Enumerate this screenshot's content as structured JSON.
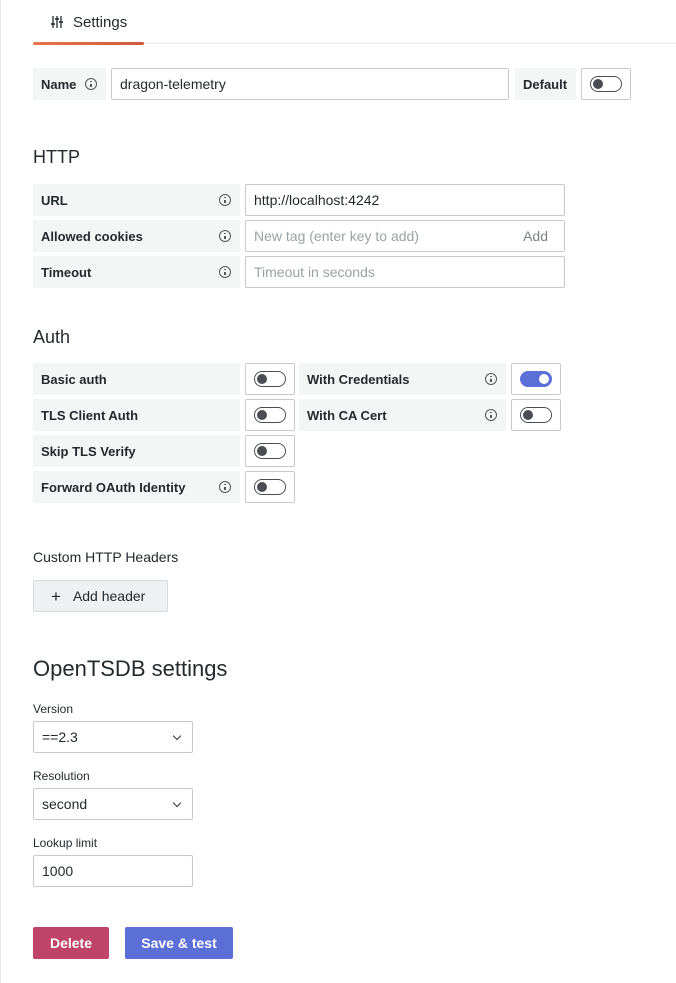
{
  "tabs": [
    {
      "label": "Settings",
      "icon": "sliders-icon",
      "active": true
    }
  ],
  "name_row": {
    "label": "Name",
    "value": "dragon-telemetry",
    "default_label": "Default",
    "default_on": false
  },
  "http": {
    "title": "HTTP",
    "url_label": "URL",
    "url_value": "http://localhost:4242",
    "cookies_label": "Allowed cookies",
    "cookies_placeholder": "New tag (enter key to add)",
    "cookies_add": "Add",
    "timeout_label": "Timeout",
    "timeout_placeholder": "Timeout in seconds"
  },
  "auth": {
    "title": "Auth",
    "basic_auth": {
      "label": "Basic auth",
      "on": false
    },
    "with_credentials": {
      "label": "With Credentials",
      "on": true
    },
    "tls_client_auth": {
      "label": "TLS Client Auth",
      "on": false
    },
    "with_ca_cert": {
      "label": "With CA Cert",
      "on": false
    },
    "skip_tls_verify": {
      "label": "Skip TLS Verify",
      "on": false
    },
    "forward_oauth": {
      "label": "Forward OAuth Identity",
      "on": false
    }
  },
  "headers": {
    "title": "Custom HTTP Headers",
    "add_label": "Add header"
  },
  "opentsdb": {
    "title": "OpenTSDB settings",
    "version_label": "Version",
    "version_value": "==2.3",
    "resolution_label": "Resolution",
    "resolution_value": "second",
    "lookup_label": "Lookup limit",
    "lookup_value": "1000"
  },
  "actions": {
    "delete_label": "Delete",
    "save_label": "Save & test"
  },
  "colors": {
    "primary": "#5b6fd6",
    "danger": "#c0446a",
    "accent": "#e8754a"
  }
}
